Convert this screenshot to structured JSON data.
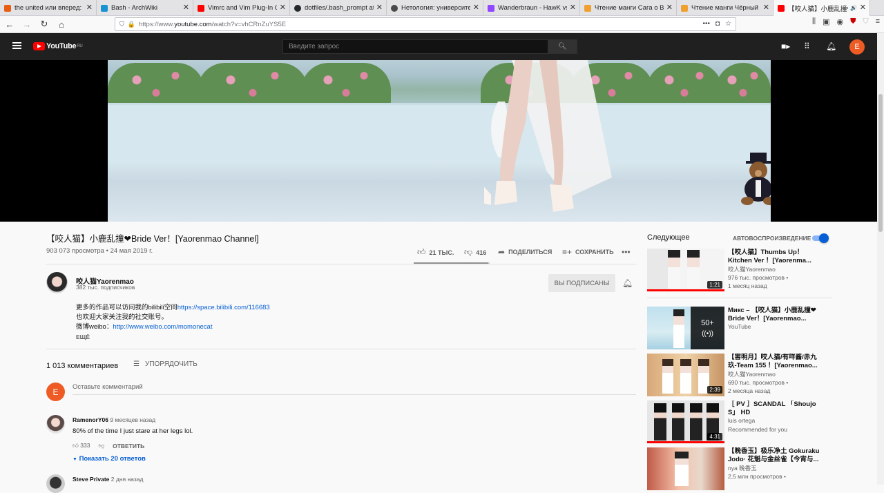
{
  "browser": {
    "tabs": [
      {
        "title": "the united или вперед: пер",
        "favicon_color": "#e85d12"
      },
      {
        "title": "Bash - ArchWiki",
        "favicon_color": "#1793d1"
      },
      {
        "title": "Vimrc and Vim Plug-In Ove",
        "favicon_color": "#ff0000"
      },
      {
        "title": "dotfiles/.bash_prompt at m",
        "favicon_color": "#24292e"
      },
      {
        "title": "Нетология: университет и",
        "favicon_color": "#4a4a4a"
      },
      {
        "title": "Wanderbraun - HawK vs N",
        "favicon_color": "#9146ff"
      },
      {
        "title": "Чтение манги Сага о Вин",
        "favicon_color": "#f0a030"
      },
      {
        "title": "Чтение манги Чёрный кл",
        "favicon_color": "#f0a030"
      },
      {
        "title": "【咬人猫】小鹿乱撞❤",
        "favicon_color": "#ff0000"
      }
    ],
    "url_prefix": "https://www.",
    "url_domain": "youtube.com",
    "url_path": "/watch?v=vhCRnZuYS5E"
  },
  "header": {
    "logo_text": "YouTube",
    "region": "RU",
    "search_placeholder": "Введите запрос",
    "avatar_letter": "E",
    "avatar_color": "#ef5b25"
  },
  "video": {
    "title": "【咬人猫】小鹿乱撞❤Bride Ver！[Yaorenmao Channel]",
    "views_date": "903 073 просмотра • 24 мая 2019 г.",
    "likes": "21 ТЫС.",
    "dislikes": "416",
    "like_ratio": 0.98,
    "share_label": "ПОДЕЛИТЬСЯ",
    "save_label": "СОХРАНИТЬ"
  },
  "channel": {
    "name": "咬人猫Yaorenmao",
    "subscribers": "382 тыс. подписчиков",
    "subscribe_label": "ВЫ ПОДПИСАНЫ",
    "desc_line1_text": "更多的作品可以访问我的bilibili空间",
    "desc_line1_link": "https://space.bilibili.com/116683",
    "desc_line2": "也欢迎大家关注我的社交账号。",
    "desc_line3_text": "微博weibo：",
    "desc_line3_link": "http://www.weibo.com/momonecat",
    "more_label": "ЕЩЁ"
  },
  "comments": {
    "count": "1 013 комментариев",
    "sort_label": "УПОРЯДОЧИТЬ",
    "add_placeholder": "Оставьте комментарий",
    "items": [
      {
        "author": "RamenorY06",
        "time": "9 месяцев назад",
        "text": "80% of the time I just stare at her legs lol.",
        "likes": "333",
        "reply_label": "ОТВЕТИТЬ",
        "show_replies": "Показать 20 ответов"
      },
      {
        "author": "Steve Private",
        "time": "2 дня назад"
      }
    ]
  },
  "sidebar": {
    "up_next": "Следующее",
    "autoplay_label": "АВТОВОСПРОИЗВЕДЕНИЕ",
    "autoplay_on": true,
    "items": [
      {
        "title": "【咬人猫】Thumbs Up！Kitchen Ver ！[Yaorenma...",
        "channel": "咬人猫Yaorenmao",
        "views": "976 тыс. просмотров •",
        "age": "1 месяц назад",
        "duration": "1:21",
        "watched": 1.0
      },
      {
        "title": "Микс – 【咬人猫】小鹿乱撞❤Bride Ver！[Yaorenmao...",
        "channel": "YouTube",
        "mix_count": "50+"
      },
      {
        "title": "【害明月】咬人猫/有咩酱/赤九玖-Team 155 ！[Yaorenmao...",
        "channel": "咬人猫Yaorenmao",
        "views": "690 тыс. просмотров •",
        "age": "2 месяца назад",
        "duration": "2:39"
      },
      {
        "title": "［ PV ］SCANDAL 「Shoujo S」 HD",
        "channel": "luis ortega",
        "views": "Recommended for you",
        "duration": "4:31",
        "watched": 1.0
      },
      {
        "title": "【晚香玉】极乐净土 Gokuraku Jodo· 花魁与金丝雀【今宵与...",
        "channel": "nya 晚香玉",
        "views": "2,5 млн просмотров •"
      }
    ]
  }
}
